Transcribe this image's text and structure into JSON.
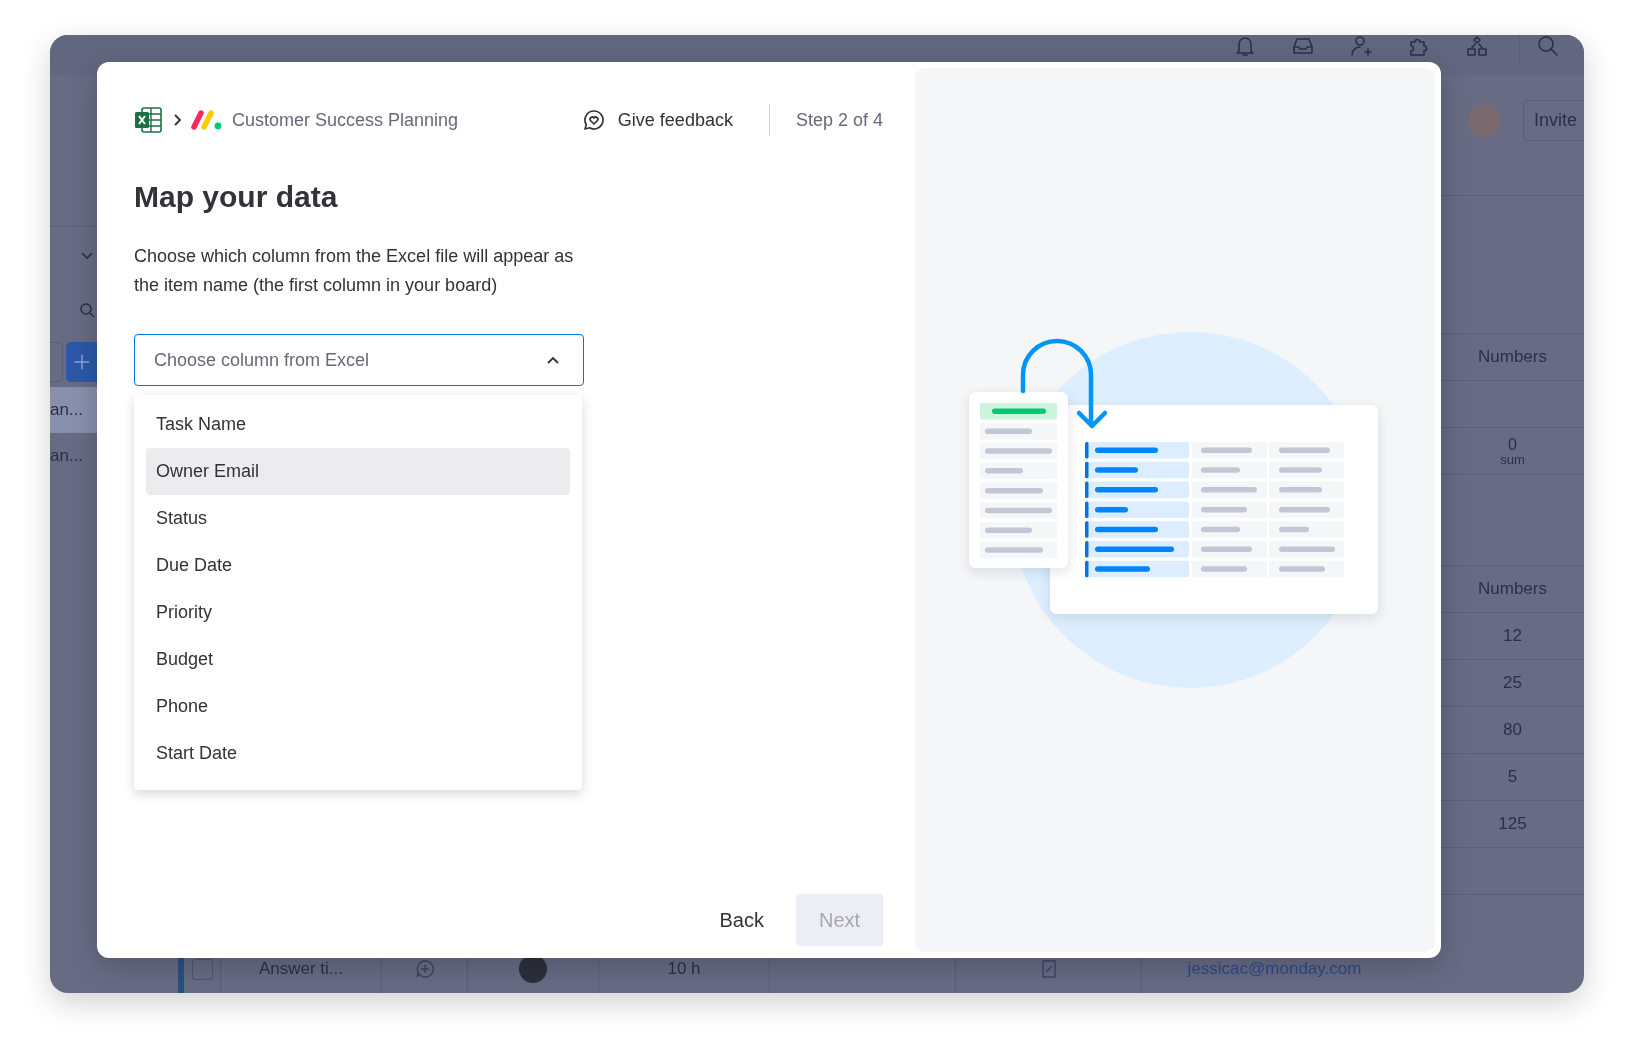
{
  "board": {
    "invite_button": "Invite",
    "left_rows": [
      {
        "label": "an...",
        "selected": true
      },
      {
        "label": "an...",
        "selected": false
      }
    ],
    "upper_group": {
      "column_header": "Numbers",
      "summary_value": "0",
      "summary_label": "sum"
    },
    "lower_group": {
      "column_header": "Numbers",
      "values": [
        "12",
        "25",
        "80",
        "5",
        "125"
      ]
    },
    "bottom_row": {
      "checked": false,
      "name": "Answer ti...",
      "time": "10 h",
      "email": "jessicac@monday.com"
    }
  },
  "modal": {
    "breadcrumb": "Customer Success Planning",
    "feedback": "Give feedback",
    "step": "Step 2 of 4",
    "title": "Map your data",
    "description": "Choose which column from the Excel file will appear as the item name (the first column in your board)",
    "dropdown": {
      "placeholder": "Choose column from Excel",
      "expanded": true
    },
    "options": [
      {
        "label": "Task Name",
        "selected": false
      },
      {
        "label": "Owner Email",
        "selected": true
      },
      {
        "label": "Status",
        "selected": false
      },
      {
        "label": "Due Date",
        "selected": false
      },
      {
        "label": "Priority",
        "selected": false
      },
      {
        "label": "Budget",
        "selected": false
      },
      {
        "label": "Phone",
        "selected": false
      },
      {
        "label": "Start Date",
        "selected": false
      }
    ],
    "back_button": "Back",
    "next_button": {
      "label": "Next",
      "disabled": true
    }
  }
}
